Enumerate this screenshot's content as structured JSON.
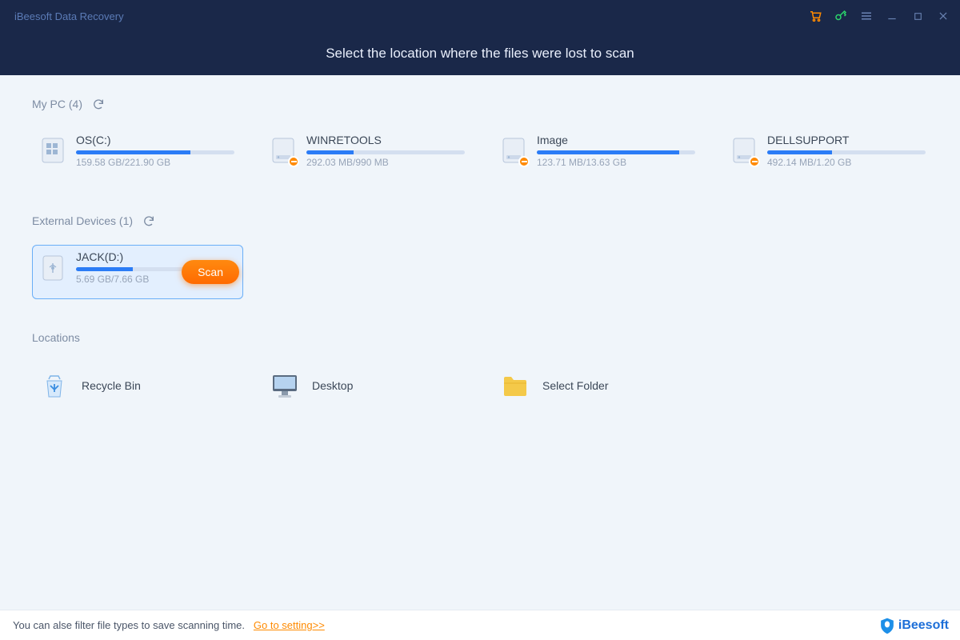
{
  "app_title": "iBeesoft Data Recovery",
  "header_text": "Select the location where the files were lost to scan",
  "sections": {
    "mypc": {
      "label": "My PC (4)"
    },
    "external": {
      "label": "External Devices (1)"
    },
    "locations": {
      "label": "Locations"
    }
  },
  "mypc_drives": [
    {
      "name": "OS(C:)",
      "size": "159.58 GB/221.90 GB",
      "fill_pct": 72,
      "badge": false,
      "icon": "windows"
    },
    {
      "name": "WINRETOOLS",
      "size": "292.03 MB/990 MB",
      "fill_pct": 30,
      "badge": true,
      "icon": "hdd"
    },
    {
      "name": "Image",
      "size": "123.71 MB/13.63 GB",
      "fill_pct": 90,
      "badge": true,
      "icon": "hdd"
    },
    {
      "name": "DELLSUPPORT",
      "size": "492.14 MB/1.20 GB",
      "fill_pct": 41,
      "badge": true,
      "icon": "hdd"
    }
  ],
  "external_drives": [
    {
      "name": "JACK(D:)",
      "size": "5.69 GB/7.66 GB",
      "fill_pct": 36,
      "badge": false,
      "icon": "usb",
      "selected": true
    }
  ],
  "scan_label": "Scan",
  "location_items": [
    {
      "name": "Recycle Bin",
      "icon": "recycle"
    },
    {
      "name": "Desktop",
      "icon": "desktop"
    },
    {
      "name": "Select Folder",
      "icon": "folder"
    }
  ],
  "footer": {
    "text": "You can alse filter file types to save scanning time.",
    "link": "Go to setting>>",
    "brand": "iBeesoft"
  }
}
